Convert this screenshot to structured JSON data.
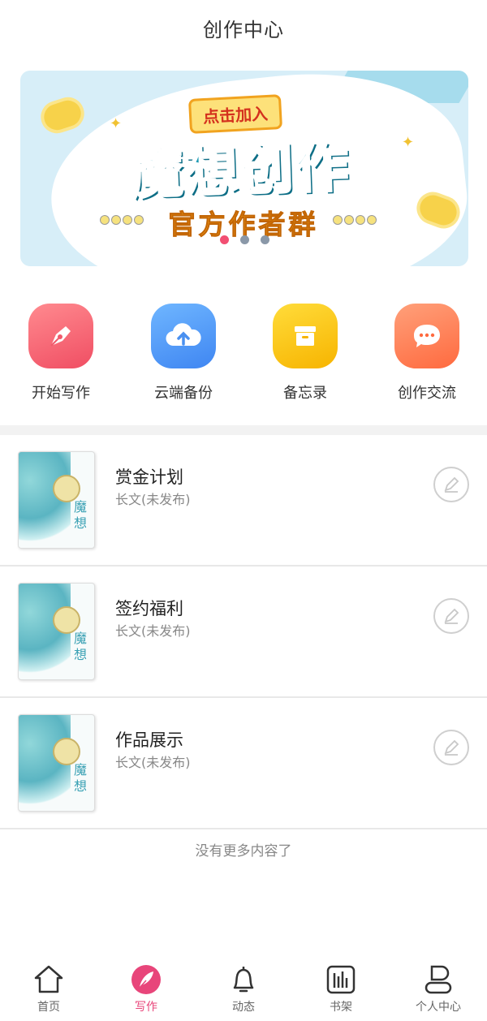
{
  "header": {
    "title": "创作中心"
  },
  "banner": {
    "tag": "点击加入",
    "headline": "魔想创作",
    "subline": "官方作者群",
    "slide_count": 3,
    "active_slide": 1
  },
  "quick_actions": [
    {
      "label": "开始写作",
      "icon": "pen-icon"
    },
    {
      "label": "云端备份",
      "icon": "cloud-upload-icon"
    },
    {
      "label": "备忘录",
      "icon": "archive-box-icon"
    },
    {
      "label": "创作交流",
      "icon": "chat-bubble-icon"
    }
  ],
  "works": [
    {
      "title": "赏金计划",
      "status": "长文(未发布)",
      "cover_text": "魔想"
    },
    {
      "title": "签约福利",
      "status": "长文(未发布)",
      "cover_text": "魔想"
    },
    {
      "title": "作品展示",
      "status": "长文(未发布)",
      "cover_text": "魔想"
    }
  ],
  "list_end_text": "没有更多内容了",
  "tabbar": {
    "items": [
      {
        "label": "首页",
        "icon": "home-icon",
        "active": false
      },
      {
        "label": "写作",
        "icon": "feather-icon",
        "active": true
      },
      {
        "label": "动态",
        "icon": "bell-icon",
        "active": false
      },
      {
        "label": "书架",
        "icon": "bookshelf-icon",
        "active": false
      },
      {
        "label": "个人中心",
        "icon": "user-icon",
        "active": false
      }
    ]
  },
  "colors": {
    "accent": "#e8457a",
    "banner_bg": "#d7eef8",
    "divider": "#e8e8e8"
  }
}
